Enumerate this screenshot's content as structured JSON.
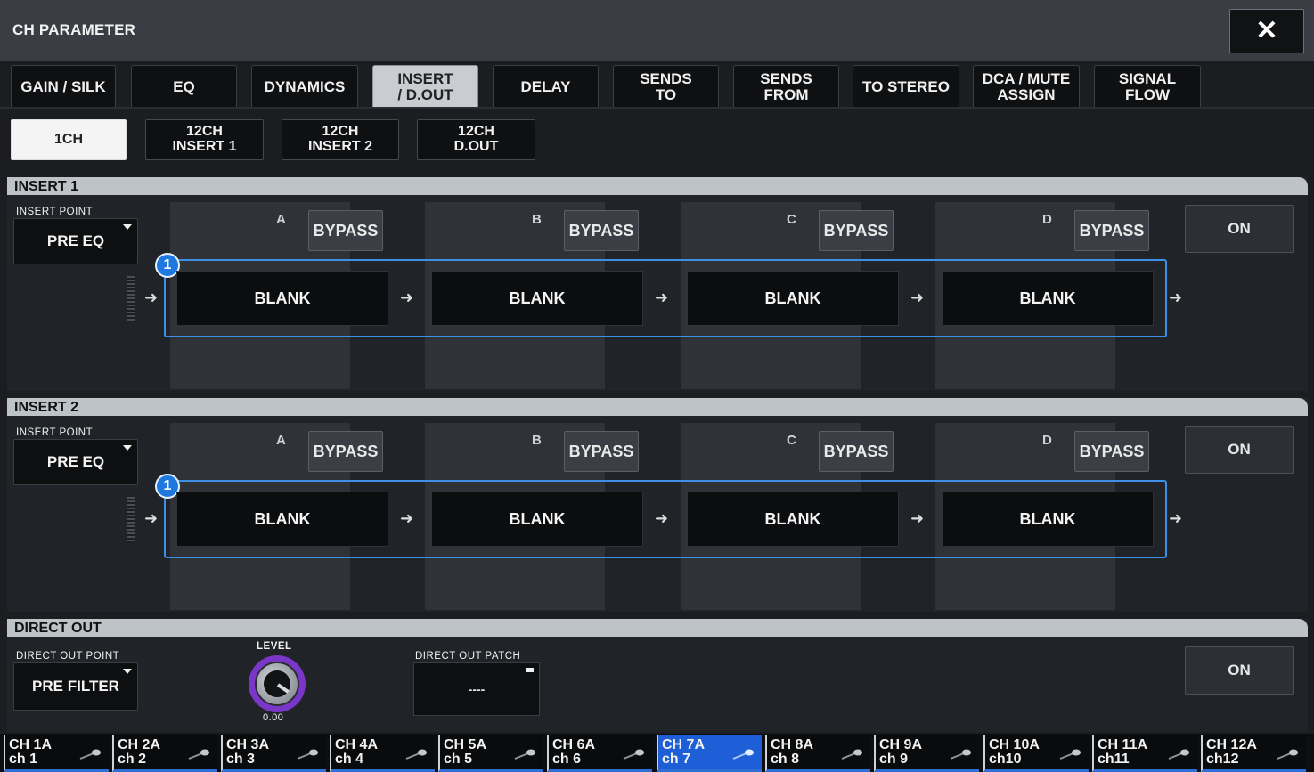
{
  "window": {
    "title": "CH PARAMETER",
    "close_icon": "close-icon"
  },
  "tabs": [
    {
      "label": "GAIN / SILK"
    },
    {
      "label": "EQ"
    },
    {
      "label": "DYNAMICS"
    },
    {
      "label": "INSERT\n/ D.OUT",
      "active": true
    },
    {
      "label": "DELAY"
    },
    {
      "label": "SENDS\nTO"
    },
    {
      "label": "SENDS\nFROM"
    },
    {
      "label": "TO STEREO"
    },
    {
      "label": "DCA / MUTE\nASSIGN"
    },
    {
      "label": "SIGNAL\nFLOW"
    }
  ],
  "subtabs": [
    {
      "label": "1CH",
      "active": true
    },
    {
      "label": "12CH\nINSERT 1"
    },
    {
      "label": "12CH\nINSERT 2"
    },
    {
      "label": "12CH\nD.OUT"
    }
  ],
  "insert1": {
    "header": "INSERT 1",
    "point_label": "INSERT POINT",
    "point_value": "PRE EQ",
    "slots": [
      {
        "letter": "A",
        "bypass": "BYPASS",
        "value": "BLANK"
      },
      {
        "letter": "B",
        "bypass": "BYPASS",
        "value": "BLANK"
      },
      {
        "letter": "C",
        "bypass": "BYPASS",
        "value": "BLANK"
      },
      {
        "letter": "D",
        "bypass": "BYPASS",
        "value": "BLANK"
      }
    ],
    "badge": "1",
    "on": "ON"
  },
  "insert2": {
    "header": "INSERT 2",
    "point_label": "INSERT POINT",
    "point_value": "PRE EQ",
    "slots": [
      {
        "letter": "A",
        "bypass": "BYPASS",
        "value": "BLANK"
      },
      {
        "letter": "B",
        "bypass": "BYPASS",
        "value": "BLANK"
      },
      {
        "letter": "C",
        "bypass": "BYPASS",
        "value": "BLANK"
      },
      {
        "letter": "D",
        "bypass": "BYPASS",
        "value": "BLANK"
      }
    ],
    "badge": "1",
    "on": "ON"
  },
  "direct_out": {
    "header": "DIRECT OUT",
    "point_label": "DIRECT OUT POINT",
    "point_value": "PRE FILTER",
    "level_label": "LEVEL",
    "level_value": "0.00",
    "patch_label": "DIRECT OUT PATCH",
    "patch_value": "----",
    "on": "ON"
  },
  "channels": [
    {
      "name": "CH 1A",
      "label": "ch 1"
    },
    {
      "name": "CH 2A",
      "label": "ch 2"
    },
    {
      "name": "CH 3A",
      "label": "ch 3"
    },
    {
      "name": "CH 4A",
      "label": "ch 4"
    },
    {
      "name": "CH 5A",
      "label": "ch 5"
    },
    {
      "name": "CH 6A",
      "label": "ch 6"
    },
    {
      "name": "CH 7A",
      "label": "ch 7",
      "selected": true
    },
    {
      "name": "CH 8A",
      "label": "ch 8"
    },
    {
      "name": "CH 9A",
      "label": "ch 9"
    },
    {
      "name": "CH 10A",
      "label": "ch10"
    },
    {
      "name": "CH 11A",
      "label": "ch11"
    },
    {
      "name": "CH 12A",
      "label": "ch12"
    }
  ],
  "colors": {
    "accent_blue": "#3e8fe6",
    "selected_channel": "#1e5fd8",
    "knob_ring": "#7a35c9",
    "section_header": "#bec3c8"
  }
}
